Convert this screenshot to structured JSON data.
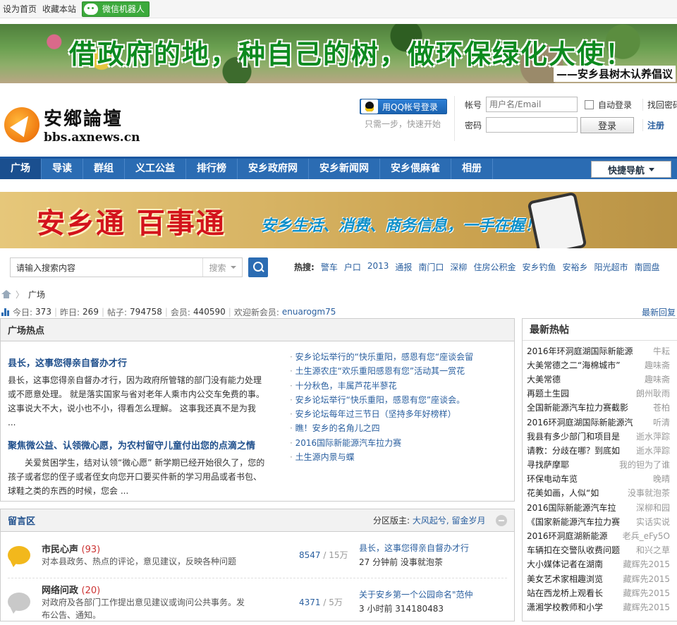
{
  "topbar": {
    "set_home": "设为首页",
    "bookmark": "收藏本站",
    "wechat": "微信机器人"
  },
  "banner1": {
    "slogan": "借政府的地，种自己的树，做环保绿化大使！",
    "sub": "——安乡县树木认养倡议"
  },
  "logo": {
    "cn": "安鄉論壇",
    "en": "bbs.axnews.cn"
  },
  "qq": {
    "label": "用QQ帐号登录",
    "hint": "只需一步，快速开始"
  },
  "login": {
    "account_label": "帐号",
    "account_placeholder": "用户名/Email",
    "password_label": "密码",
    "auto_login": "自动登录",
    "submit": "登录",
    "find_password": "找回密码",
    "register": "注册"
  },
  "nav": {
    "items": [
      "广场",
      "导读",
      "群组",
      "义工公益",
      "排行榜",
      "安乡政府网",
      "安乡新闻网",
      "安乡偎麻雀",
      "相册"
    ],
    "quick": "快捷导航"
  },
  "banner2": {
    "b1": "安乡通 百事通",
    "b2": "安乡生活、消费、商务信息，一手在握！"
  },
  "search": {
    "placeholder": "请输入搜索内容",
    "type": "搜索",
    "hot_label": "热搜:",
    "hot": [
      "警车",
      "户口",
      "2013",
      "通报",
      "南门口",
      "深柳",
      "住房公积金",
      "安乡钓鱼",
      "安裕乡",
      "阳光超市",
      "南圆盘"
    ]
  },
  "crumb": {
    "current": "广场"
  },
  "stats": {
    "today_label": "今日:",
    "today": "373",
    "yesterday_label": "昨日:",
    "yesterday": "269",
    "posts_label": "帖子:",
    "posts": "794758",
    "members_label": "会员:",
    "members": "440590",
    "welcome": "欢迎新会员:",
    "new_member": "enuarogm75",
    "latest_reply": "最新回复"
  },
  "plaza": {
    "title": "广场热点",
    "featured": [
      {
        "title": "县长，这事您得亲自督办才行",
        "body": "县长，这事您得亲自督办才行，因为政府所管辖的部门没有能力处理或不愿意处理。 就是落实国家与省对老年人乘市内公交车免费的事。这事说大不大，说小也不小，得看怎么理解。 这事我还真不是为我 ..."
      },
      {
        "title": "聚焦微公益、认领微心愿，为农村留守儿童付出您的点滴之情",
        "body": "关爱贫困学生，结对认领“微心愿” 新学期已经开始很久了，您的孩子或者您的侄子或者侄女向您开口要买件新的学习用品或者书包、球鞋之类的东西的时候，您会 ..."
      }
    ],
    "hotlist": [
      "安乡论坛举行的“快乐重阳，感恩有您“座谈会留",
      "土生源农庄“欢乐重阳感恩有您”活动其一赏花",
      "十分秋色，丰属芦花半蓼花",
      "安乡论坛举行“快乐重阳，感恩有您”座谈会。",
      "安乡论坛每年过三节日（坚持多年好榜样）",
      "瞧！安乡的名角儿之四",
      "2016国际新能源汽车拉力赛",
      "土生源内景与蝶"
    ]
  },
  "board": {
    "title": "留言区",
    "moderators_label": "分区版主:",
    "moderators": "大风起兮, 留金岁月",
    "forums": [
      {
        "name": "市民心声",
        "count": "(93)",
        "desc": "对本县政务、热点的评论，意见建议，反映各种问题",
        "threads": "8547",
        "posts": "/ 15万",
        "last_title": "县长，这事您得亲自督办才行",
        "last_time": "27 分钟前",
        "last_user": "没事就泡茶",
        "color": "#f2b81c"
      },
      {
        "name": "网络问政",
        "count": "(20)",
        "desc": "对政府及各部门工作提出意见建议或询问公共事务。发布公告、通知。",
        "threads": "4371",
        "posts": "/ 5万",
        "last_title": "关于安乡第一个公园命名\"范仲",
        "last_time": "3 小时前",
        "last_user": "314180483",
        "color": "#c9c9c9"
      }
    ]
  },
  "latest": {
    "title": "最新热帖",
    "items": [
      {
        "t": "2016年环洞庭湖国际新能源",
        "u": "牛耘"
      },
      {
        "t": "大美常德之二“海棉城市”",
        "u": "趣味斋"
      },
      {
        "t": "大美常德",
        "u": "趣味斋"
      },
      {
        "t": "再题土生园",
        "u": "朗州耿雨"
      },
      {
        "t": "全国新能源汽车拉力赛截影",
        "u": "苍柏"
      },
      {
        "t": "2016环洞庭湖国际新能源汽",
        "u": "听清"
      },
      {
        "t": "我县有多少部门和项目是",
        "u": "逝水萍踪"
      },
      {
        "t": "请教：分歧在哪？到底如",
        "u": "逝水萍踪"
      },
      {
        "t": "寻找萨摩耶",
        "u": "我的钽为了谁"
      },
      {
        "t": "环保电动车览",
        "u": "晚晴"
      },
      {
        "t": "花美如画，人似“如",
        "u": "没事就泡茶"
      },
      {
        "t": "2016国际新能源汽车拉",
        "u": "深柳和园"
      },
      {
        "t": "《国家新能源汽车拉力赛",
        "u": "实话实说"
      },
      {
        "t": "2016环洞庭湖新能源",
        "u": "老兵_eFy5O"
      },
      {
        "t": "车辆扣在交警队收费问题",
        "u": "和兴之草"
      },
      {
        "t": "大小媒体记者在湖南",
        "u": "藏辉先2015"
      },
      {
        "t": "美女艺术家相趣浏览",
        "u": "藏辉先2015"
      },
      {
        "t": "站在西龙桥上观看长",
        "u": "藏辉先2015"
      },
      {
        "t": "潇湘学校教师和小学",
        "u": "藏辉先2015"
      }
    ]
  },
  "colors": {
    "nav": "#2b6cb3",
    "link": "#2a5f9f",
    "accent": "#c33"
  }
}
